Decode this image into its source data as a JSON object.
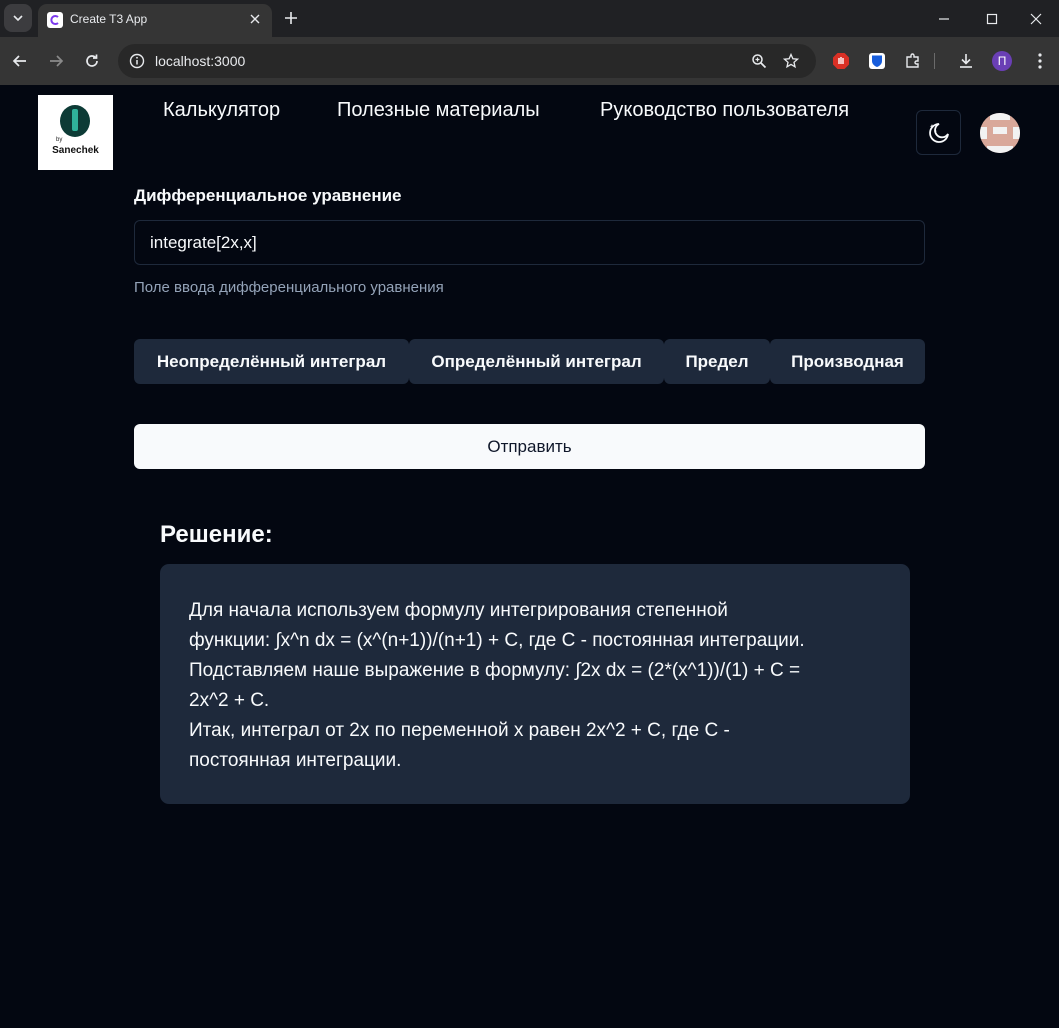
{
  "browser": {
    "tab_title": "Create T3 App",
    "url": "localhost:3000",
    "profile_initial": "П"
  },
  "logo": {
    "by": "by",
    "text": "Sanechek"
  },
  "nav": {
    "items": [
      {
        "label": "Калькулятор"
      },
      {
        "label": "Полезные материалы"
      },
      {
        "label": "Руководство пользователя"
      }
    ]
  },
  "form": {
    "label": "Дифференциальное уравнение",
    "input_value": "integrate[2x,x]",
    "description": "Поле ввода дифференциального уравнения",
    "modes": [
      {
        "label": "Неопределённый интеграл"
      },
      {
        "label": "Определённый интеграл"
      },
      {
        "label": "Предел"
      },
      {
        "label": "Производная"
      }
    ],
    "submit_label": "Отправить"
  },
  "solution": {
    "title": "Решение:",
    "lines": [
      "Для начала используем формулу интегрирования степенной",
      "функции: ∫x^n dx = (x^(n+1))/(n+1) + C, где C - постоянная интеграции.",
      "Подставляем наше выражение в формулу: ∫2x dx = (2*(x^1))/(1) + C =",
      "2x^2 + C.",
      "Итак, интеграл от 2x по переменной x равен 2x^2 + C, где C -",
      "постоянная интеграции."
    ]
  },
  "colors": {
    "page_bg": "#030711",
    "card_bg": "#1e293b",
    "muted_text": "#94a3b8",
    "primary_button_bg": "#f8fafc"
  }
}
